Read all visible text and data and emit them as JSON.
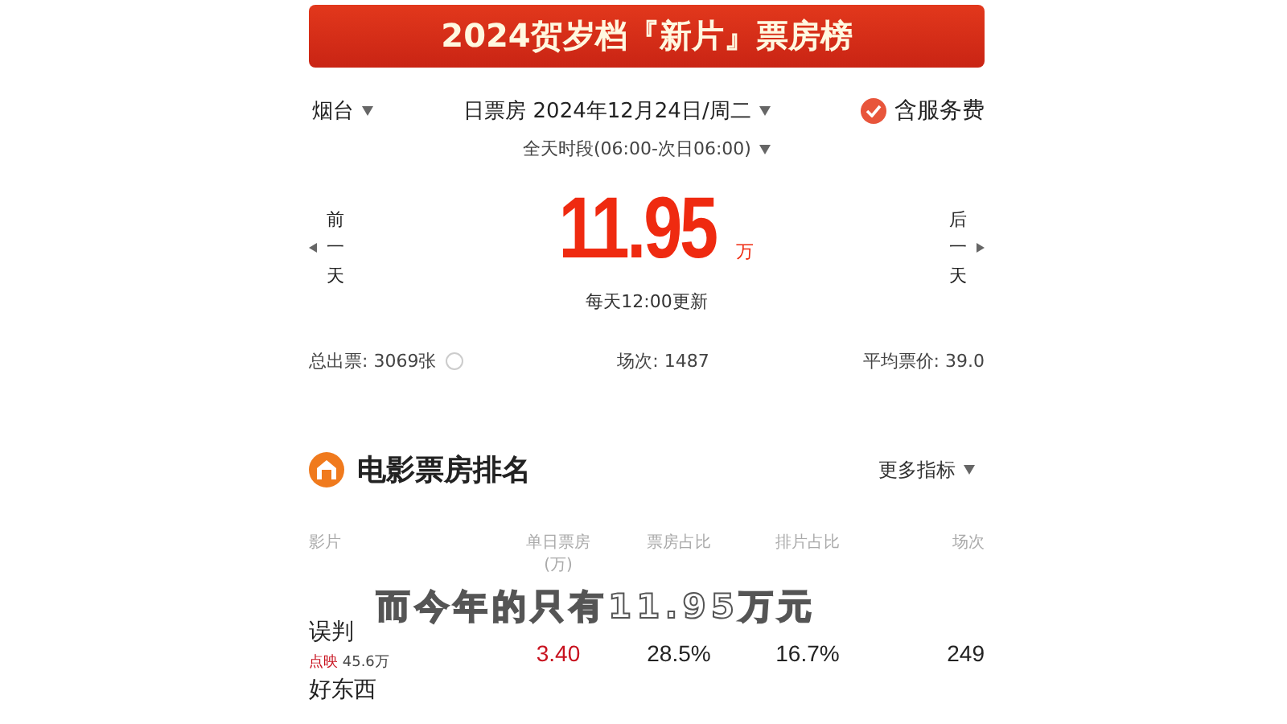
{
  "banner": {
    "title": "2024贺岁档『新片』票房榜"
  },
  "filters": {
    "city": "烟台",
    "date": "日票房 2024年12月24日/周二",
    "service_fee": {
      "label": "含服务费",
      "checked": true
    },
    "period": "全天时段(06:00-次日06:00)"
  },
  "summary": {
    "prev": "前一天",
    "next": "后一天",
    "amount": "11.95",
    "unit": "万",
    "update_note": "每天12:00更新"
  },
  "stats": [
    {
      "label": "总出票: 3069张",
      "info": true
    },
    {
      "label": "场次: 1487",
      "info": false
    },
    {
      "label": "平均票价: 39.0",
      "info": false
    }
  ],
  "ranking": {
    "title": "电影票房排名",
    "more": "更多指标",
    "columns": [
      {
        "label": "影片"
      },
      {
        "label": "单日票房\n(万)"
      },
      {
        "label": "票房占比"
      },
      {
        "label": "排片占比"
      },
      {
        "label": "场次"
      }
    ],
    "rows": [
      {
        "title": "误判",
        "tag": "点映",
        "tag_value": "45.6万",
        "box_office": "3.40",
        "share": "28.5%",
        "screen_share": "16.7%",
        "shows": "249"
      },
      {
        "title": "好东西"
      }
    ]
  },
  "subtitle": "而今年的只有11.95万元"
}
